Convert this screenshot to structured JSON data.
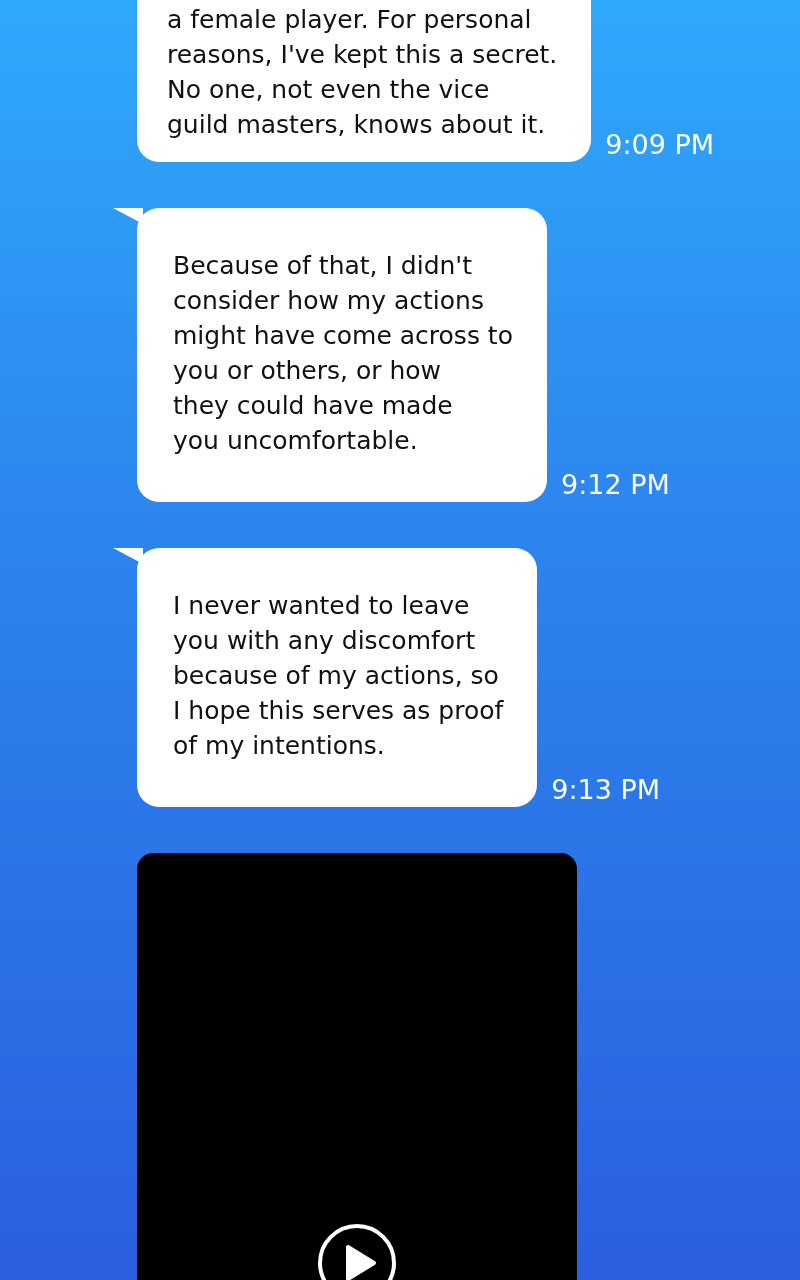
{
  "messages": [
    {
      "kind": "text",
      "text": "a female player. For personal\nreasons, I've kept this a secret.\nNo one, not even the vice\nguild masters, knows about it.",
      "time": "9:09 PM"
    },
    {
      "kind": "text",
      "text": "Because of that, I didn't\nconsider how my actions\nmight have come across to\nyou or others, or how\nthey could have made\nyou uncomfortable.",
      "time": "9:12 PM"
    },
    {
      "kind": "text",
      "text": "I never wanted to leave\nyou with any discomfort\nbecause of my actions, so\nI hope this serves as proof\nof my intentions.",
      "time": "9:13 PM"
    },
    {
      "kind": "video"
    }
  ]
}
